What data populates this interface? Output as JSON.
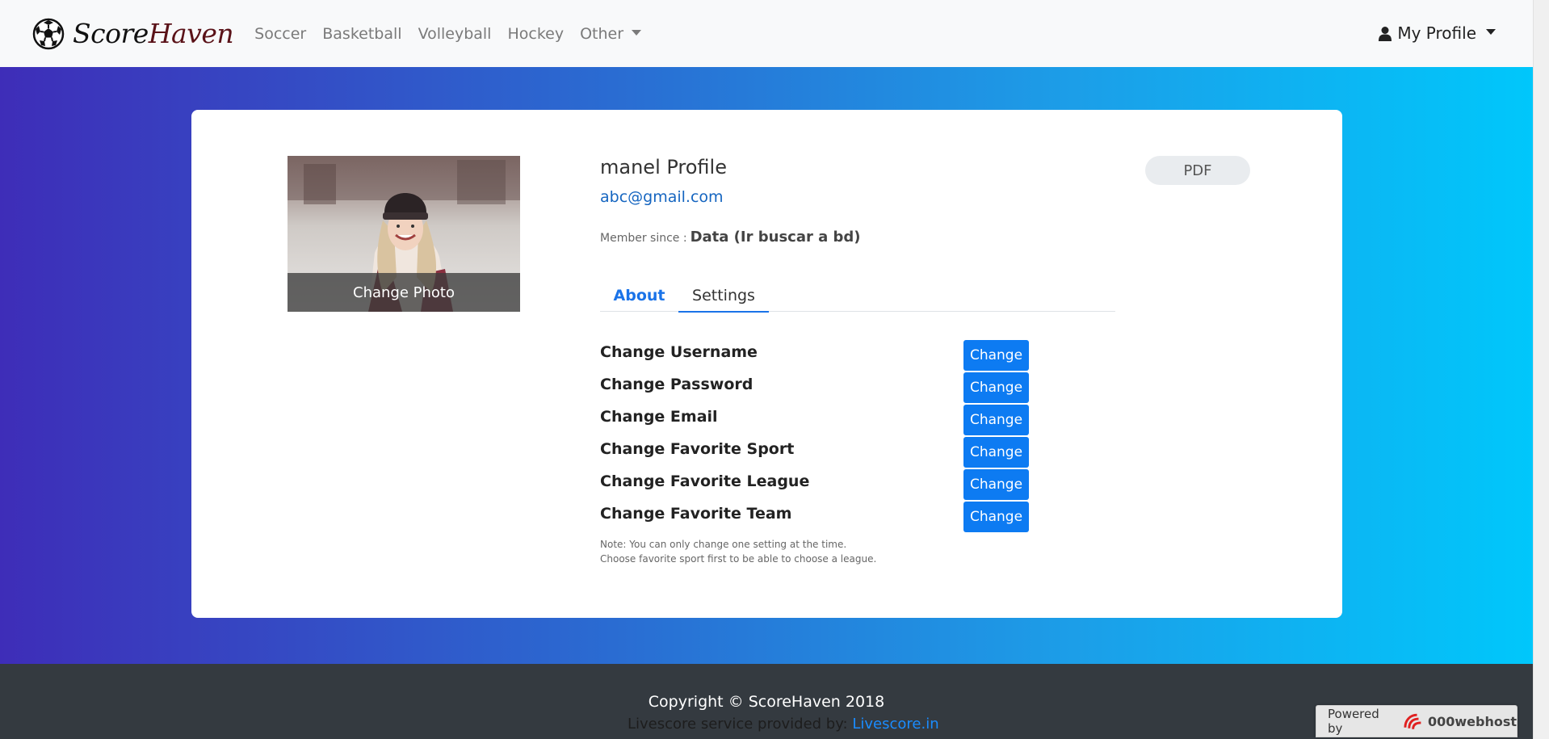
{
  "navbar": {
    "brand_part1": "Score",
    "brand_part2": "Haven",
    "brand_icon": "soccer-ball-icon",
    "links": [
      "Soccer",
      "Basketball",
      "Volleyball",
      "Hockey",
      "Other"
    ],
    "profile_label": "My Profile",
    "profile_icon": "user-icon"
  },
  "profile": {
    "photo_overlay": "Change Photo",
    "name": "manel Profile",
    "email": "abc@gmail.com",
    "member_since_label": "Member since :",
    "member_since_value": "Data (Ir buscar a bd)",
    "pdf_label": "PDF"
  },
  "tabs": {
    "about": "About",
    "settings": "Settings",
    "active": "Settings"
  },
  "settings": {
    "rows": [
      {
        "label": "Change Username",
        "button": "Change"
      },
      {
        "label": "Change Password",
        "button": "Change"
      },
      {
        "label": "Change Email",
        "button": "Change"
      },
      {
        "label": "Change Favorite Sport",
        "button": "Change"
      },
      {
        "label": "Change Favorite League",
        "button": "Change"
      },
      {
        "label": "Change Favorite Team",
        "button": "Change"
      }
    ],
    "note_line1": "Note: You can only change one setting at the time.",
    "note_line2": "Choose favorite sport first to be able to choose a league."
  },
  "footer": {
    "copyright": "Copyright © ScoreHaven 2018",
    "live_text": "Livescore service provided by:",
    "live_link": "Livescore.in"
  },
  "powered": {
    "label": "Powered by",
    "brand": "000webhost"
  },
  "colors": {
    "gradient_start": "#3e2db8",
    "gradient_end": "#00c7fb",
    "primary_button": "#0d7bf2",
    "link": "#1a73e8",
    "footer_bg": "#343a40"
  }
}
